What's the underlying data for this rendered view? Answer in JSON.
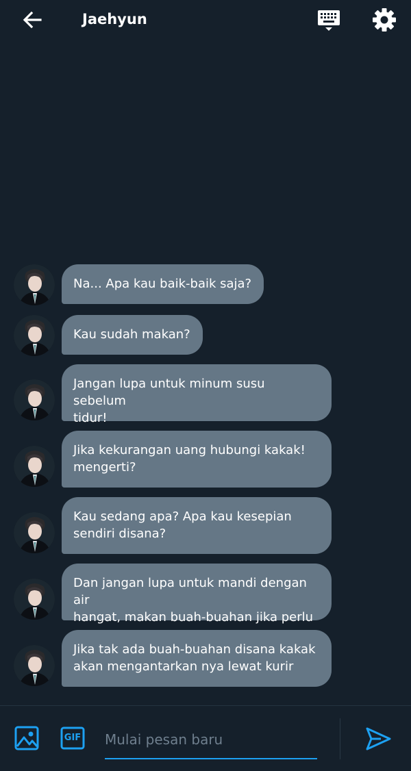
{
  "header": {
    "title": "Jaehyun"
  },
  "icons": {
    "back": "arrow-left",
    "keyboard": "keyboard",
    "settings": "gear",
    "image": "image",
    "gif": "gif",
    "send": "send"
  },
  "colors": {
    "background": "#15202b",
    "bubble": "#657786",
    "accent": "#1da1f2"
  },
  "messages": [
    {
      "sender": "Jaehyun",
      "lines": [
        "Na... Apa kau baik-baik saja?"
      ]
    },
    {
      "sender": "Jaehyun",
      "lines": [
        "Kau sudah makan?"
      ]
    },
    {
      "sender": "Jaehyun",
      "lines": [
        "Jangan lupa untuk minum susu sebelum",
        "tidur!"
      ]
    },
    {
      "sender": "Jaehyun",
      "lines": [
        "Jika kekurangan uang hubungi kakak!",
        "mengerti?"
      ]
    },
    {
      "sender": "Jaehyun",
      "lines": [
        "Kau sedang apa? Apa kau kesepian",
        "sendiri disana?"
      ]
    },
    {
      "sender": "Jaehyun",
      "lines": [
        "Dan jangan lupa untuk mandi dengan air",
        "hangat, makan buah-buahan jika perlu"
      ]
    },
    {
      "sender": "Jaehyun",
      "lines": [
        "Jika tak ada buah-buahan disana kakak",
        "akan mengantarkan nya lewat kurir"
      ]
    }
  ],
  "composer": {
    "gif_label": "GIF",
    "placeholder": "Mulai pesan baru",
    "value": ""
  }
}
